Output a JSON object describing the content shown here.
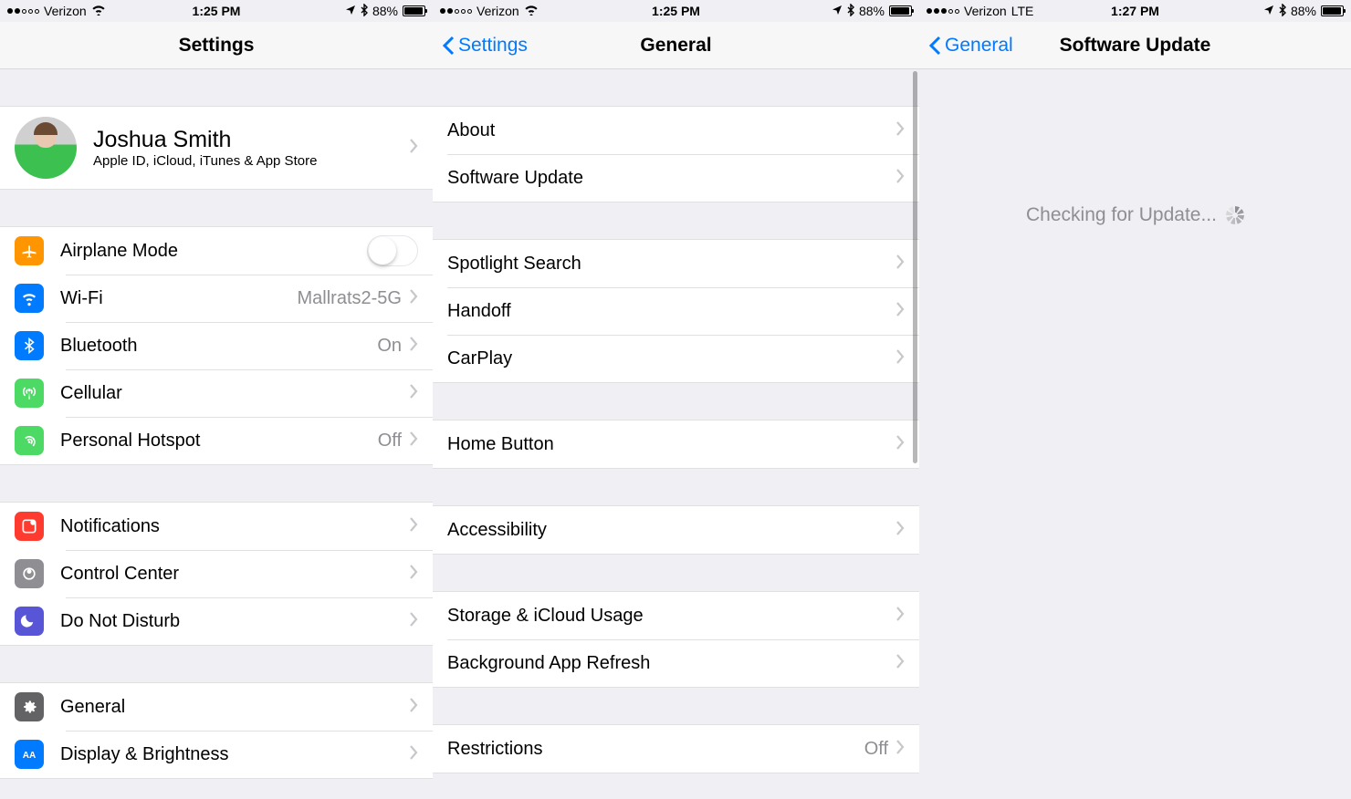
{
  "statusA": {
    "dots_filled": 2,
    "dots_total": 5,
    "carrier": "Verizon",
    "network_icon": "wifi",
    "time": "1:25 PM",
    "battery_pct": "88%"
  },
  "statusB": {
    "dots_filled": 2,
    "dots_total": 5,
    "carrier": "Verizon",
    "network_icon": "wifi",
    "time": "1:25 PM",
    "battery_pct": "88%"
  },
  "statusC": {
    "dots_filled": 3,
    "dots_total": 5,
    "carrier": "Verizon",
    "network_label": "LTE",
    "time": "1:27 PM",
    "battery_pct": "88%"
  },
  "navA": {
    "title": "Settings"
  },
  "navB": {
    "back": "Settings",
    "title": "General"
  },
  "navC": {
    "back": "General",
    "title": "Software Update"
  },
  "profile": {
    "name": "Joshua Smith",
    "subtitle": "Apple ID, iCloud, iTunes & App Store"
  },
  "settings_groups": [
    [
      {
        "icon": "airplane",
        "icon_color": "ic-orange",
        "label": "Airplane Mode",
        "accessory": "toggle",
        "toggle_on": false
      },
      {
        "icon": "wifi",
        "icon_color": "ic-blue",
        "label": "Wi-Fi",
        "value": "Mallrats2-5G",
        "accessory": "chevron"
      },
      {
        "icon": "bluetooth",
        "icon_color": "ic-blue",
        "label": "Bluetooth",
        "value": "On",
        "accessory": "chevron"
      },
      {
        "icon": "cellular",
        "icon_color": "ic-green",
        "label": "Cellular",
        "accessory": "chevron"
      },
      {
        "icon": "hotspot",
        "icon_color": "ic-green",
        "label": "Personal Hotspot",
        "value": "Off",
        "accessory": "chevron"
      }
    ],
    [
      {
        "icon": "notifications",
        "icon_color": "ic-red",
        "label": "Notifications",
        "accessory": "chevron"
      },
      {
        "icon": "controlcenter",
        "icon_color": "ic-gray",
        "label": "Control Center",
        "accessory": "chevron"
      },
      {
        "icon": "dnd",
        "icon_color": "ic-purple",
        "label": "Do Not Disturb",
        "accessory": "chevron"
      }
    ],
    [
      {
        "icon": "general",
        "icon_color": "ic-darkgray",
        "label": "General",
        "accessory": "chevron"
      },
      {
        "icon": "display",
        "icon_color": "ic-blue",
        "label": "Display & Brightness",
        "accessory": "chevron"
      }
    ]
  ],
  "general_groups": [
    [
      {
        "label": "About",
        "accessory": "chevron"
      },
      {
        "label": "Software Update",
        "accessory": "chevron"
      }
    ],
    [
      {
        "label": "Spotlight Search",
        "accessory": "chevron"
      },
      {
        "label": "Handoff",
        "accessory": "chevron"
      },
      {
        "label": "CarPlay",
        "accessory": "chevron"
      }
    ],
    [
      {
        "label": "Home Button",
        "accessory": "chevron"
      }
    ],
    [
      {
        "label": "Accessibility",
        "accessory": "chevron"
      }
    ],
    [
      {
        "label": "Storage & iCloud Usage",
        "accessory": "chevron"
      },
      {
        "label": "Background App Refresh",
        "accessory": "chevron"
      }
    ],
    [
      {
        "label": "Restrictions",
        "value": "Off",
        "accessory": "chevron"
      }
    ]
  ],
  "update": {
    "status": "Checking for Update..."
  }
}
